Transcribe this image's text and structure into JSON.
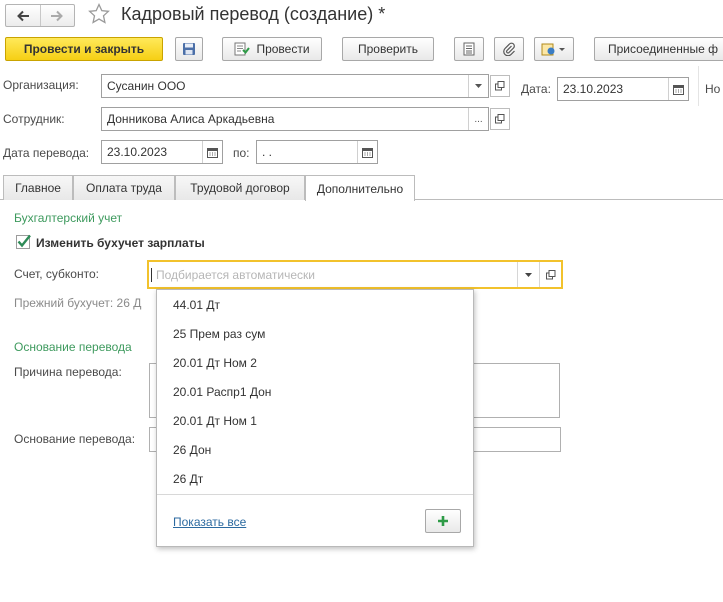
{
  "window": {
    "title": "Кадровый перевод (создание) *"
  },
  "toolbar": {
    "post_close": "Провести и закрыть",
    "post": "Провести",
    "check": "Проверить",
    "attached_files": "Присоединенные ф"
  },
  "header": {
    "org_label": "Организация:",
    "org_value": "Сусанин ООО",
    "date_label": "Дата:",
    "date_value": "23.10.2023",
    "number_label_cut": "Но",
    "employee_label": "Сотрудник:",
    "employee_value": "Донникова Алиса Аркадьевна",
    "transfer_date_label": "Дата перевода:",
    "transfer_date_value": "23.10.2023",
    "to_label": "по:",
    "to_value": " .  ."
  },
  "tabs": [
    {
      "label": "Главное"
    },
    {
      "label": "Оплата труда"
    },
    {
      "label": "Трудовой договор"
    },
    {
      "label": "Дополнительно"
    }
  ],
  "accounting": {
    "section_title": "Бухгалтерский учет",
    "change_checkbox_label": "Изменить бухучет зарплаты",
    "change_checked": true,
    "account_label": "Счет, субконто:",
    "account_placeholder": "Подбирается автоматически",
    "previous_label": "Прежний бухучет: 26 Д"
  },
  "basis": {
    "section_title": "Основание перевода",
    "reason_label": "Причина перевода:",
    "basis_label": "Основание перевода:"
  },
  "dropdown": {
    "items": [
      "44.01 Дт",
      "25 Прем раз сум",
      "20.01 Дт Ном 2",
      "20.01 Распр1 Дон",
      "20.01 Дт Ном 1",
      "26 Дон",
      "26 Дт"
    ],
    "show_all": "Показать все"
  },
  "colors": {
    "primary_button": "#f6cf14",
    "section_title": "#3e9a5e",
    "focus_border": "#f2c22c",
    "link": "#2c6aa0",
    "check_mark": "#2e8b57",
    "add_plus": "#2e9b47"
  }
}
